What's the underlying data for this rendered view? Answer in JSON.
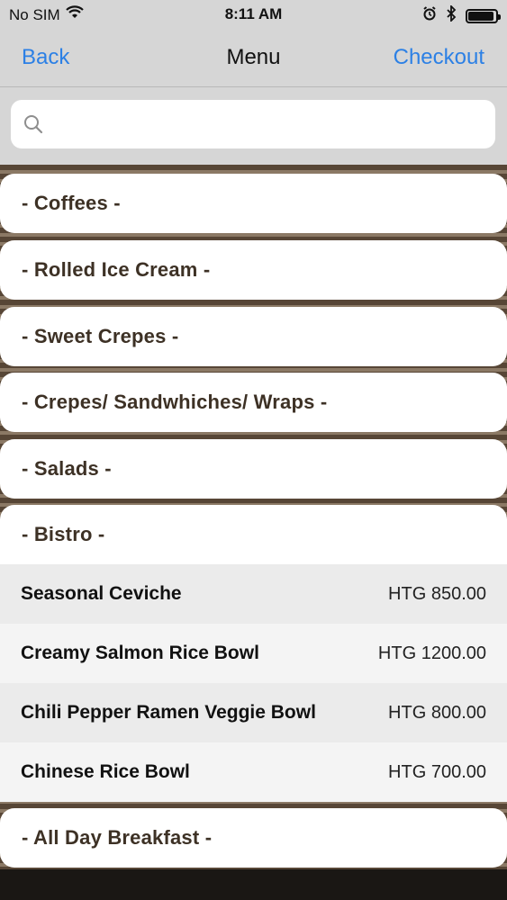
{
  "status_bar": {
    "carrier": "No SIM",
    "time": "8:11 AM"
  },
  "nav": {
    "back_label": "Back",
    "title": "Menu",
    "checkout_label": "Checkout"
  },
  "search": {
    "placeholder": ""
  },
  "categories": [
    {
      "label": "- Coffees -"
    },
    {
      "label": "- Rolled Ice Cream -"
    },
    {
      "label": "- Sweet Crepes -"
    },
    {
      "label": "- Crepes/ Sandwhiches/ Wraps -"
    },
    {
      "label": "- Salads -"
    },
    {
      "label": "- Bistro -"
    },
    {
      "label": "- All Day Breakfast -"
    }
  ],
  "bistro_items": [
    {
      "name": "Seasonal Ceviche",
      "price": "HTG 850.00"
    },
    {
      "name": "Creamy Salmon Rice Bowl",
      "price": "HTG 1200.00"
    },
    {
      "name": "Chili Pepper Ramen Veggie Bowl",
      "price": "HTG 800.00"
    },
    {
      "name": "Chinese Rice Bowl",
      "price": "HTG 700.00"
    }
  ],
  "colors": {
    "accent": "#2c80e5",
    "category_text": "#3d3125",
    "background": "#574636"
  }
}
